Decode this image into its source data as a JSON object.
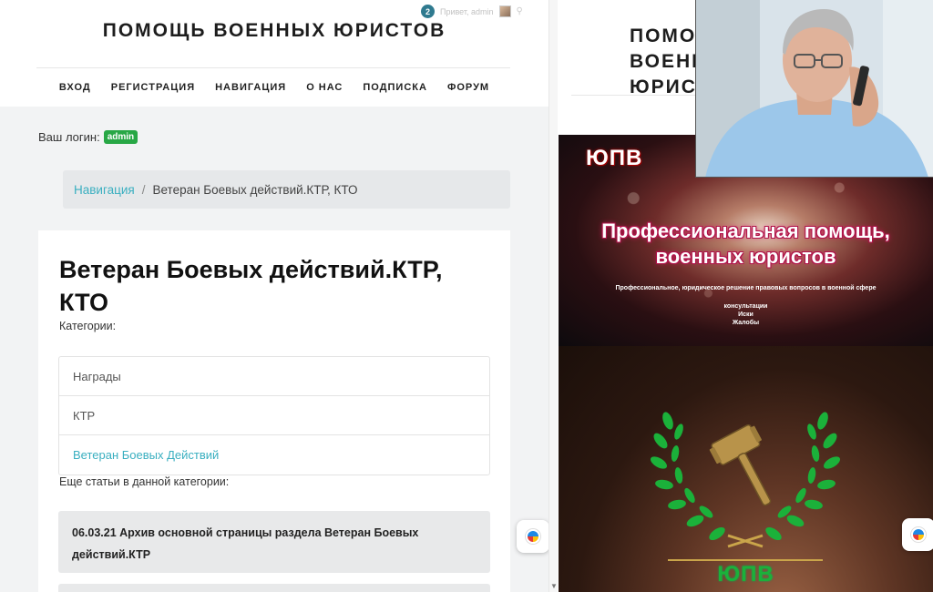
{
  "left": {
    "site_title": "ПОМОЩЬ ВОЕННЫХ ЮРИСТОВ",
    "topbar": {
      "notification_count": "2",
      "greeting": "Привет, admin"
    },
    "menu": [
      "ВХОД",
      "РЕГИСТРАЦИЯ",
      "НАВИГАЦИЯ",
      "О НАС",
      "ПОДПИСКА",
      "ФОРУМ"
    ],
    "login_label": "Ваш логин:",
    "login_user": "admin",
    "breadcrumb": {
      "link": "Навигация",
      "separator": "/",
      "current": "Ветеран Боевых действий.КТР, КТО"
    },
    "article_title": "Ветеран Боевых действий.КТР, КТО",
    "categories_label": "Категории:",
    "categories": [
      "Награды",
      "КТР",
      "Ветеран Боевых Действий"
    ],
    "more_label": "Еще статьи в данной категории:",
    "articles": [
      "06.03.21 Архив основной страницы раздела Ветеран Боевых действий.КТР"
    ]
  },
  "right": {
    "site_title": "ПОМОЩЬ ВОЕННЫХ ЮРИСТОВ",
    "banner1": {
      "logo": "ЮПВ",
      "headline_line1": "Профессиональная помощь,",
      "headline_line2": "военных юристов",
      "subline": "Профессиональное, юридическое решение правовых вопросов в военной сфере",
      "services": [
        "консультации",
        "Иски",
        "Жалобы"
      ]
    },
    "banner2": {
      "logo": "ЮПВ"
    }
  },
  "colors": {
    "accent_teal": "#3aafc0",
    "badge_green": "#28a745",
    "banner_headline_pink": "#b0124a",
    "laurel_green": "#1bb13a",
    "gavel_gold": "#b8934a"
  }
}
